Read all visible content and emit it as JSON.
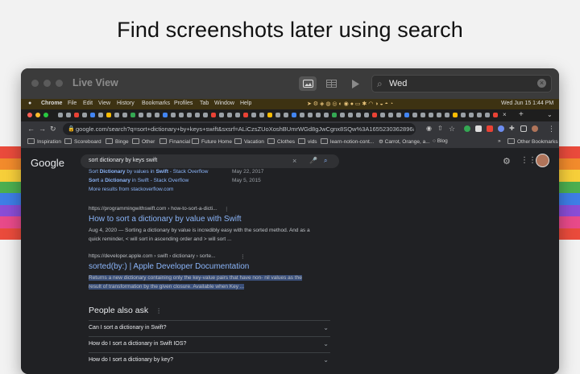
{
  "headline": "Find screenshots later using search",
  "stripe_colors": [
    "#ea4b3c",
    "#f28b2c",
    "#f7cf3a",
    "#4caf50",
    "#3e7ee6",
    "#8a4dd6",
    "#e84a8a",
    "#ea4b3c"
  ],
  "live_view": {
    "title": "Live View",
    "search_value": "Wed"
  },
  "menubar": {
    "app": "Chrome",
    "items": [
      "File",
      "Edit",
      "View",
      "History",
      "Bookmarks",
      "Profiles",
      "Tab",
      "Window",
      "Help"
    ],
    "clock": "Wed Jun 15  1:44 PM"
  },
  "omnibox": {
    "url": "google.com/search?q=sort+dictionary+by+keys+swift&sxsrf=ALiCzsZUoXoshBUmrWGd8gJwCgnx8SQw%3A1655230362896&ei=ms-oY..."
  },
  "bookmarks": {
    "items": [
      "Inspiration",
      "Scoreboard",
      "Binge",
      "Other",
      "Financial",
      "Future Home",
      "Vacation",
      "Clothes",
      "vids",
      "learn-notion-cont...",
      "Carrot, Orange, a...",
      "Blog"
    ],
    "other": "Other Bookmarks"
  },
  "google": {
    "logo": "Google",
    "query": "sort dictionary by keys swift",
    "sublinks": [
      {
        "pre": "Sort ",
        "b1": "Dictionary",
        "mid": " by values in ",
        "b2": "Swift",
        "post": " - Stack Overflow",
        "date": "May 22, 2017"
      },
      {
        "pre": "Sort",
        "b1": " a ",
        "mid": "Dictionary",
        "b2": " in Swift",
        "post": " - Stack Overflow",
        "date": "May 5, 2015"
      }
    ],
    "more_results": "More results from stackoverflow.com",
    "result1": {
      "cite": "https://programmingwithswift.com › how-to-sort-a-dicti...",
      "title": "How to sort a dictionary by value with Swift",
      "snippet_line1": "Aug 4, 2020 — Sorting a dictionary by value is incredibly easy with the sorted method. And as a",
      "snippet_line2": "quick reminder, < will sort in ascending order and > will sort ..."
    },
    "result2": {
      "cite": "https://developer.apple.com › swift › dictionary › sorte...",
      "title": "sorted(by:) | Apple Developer Documentation",
      "snippet_line1": "Returns a new dictionary containing only the key-value pairs that have non- nil values as the",
      "snippet_line2": "result of transformation by the given closure. Available when Key ..."
    },
    "people_also_ask": "People also ask",
    "questions": [
      "Can I sort a dictionary in Swift?",
      "How do I sort a dictionary in Swift IOS?",
      "How do I sort a dictionary by key?"
    ]
  }
}
